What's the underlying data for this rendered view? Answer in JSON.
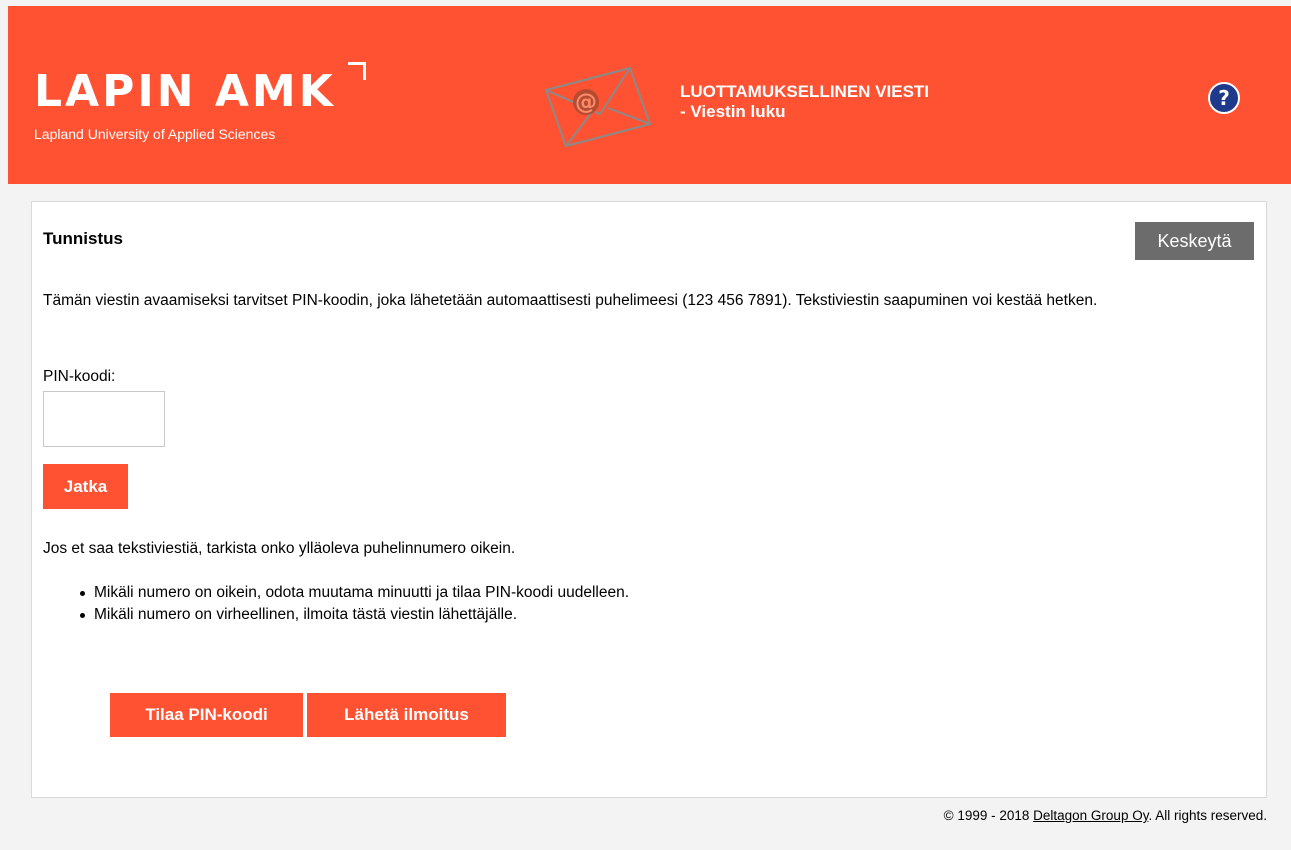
{
  "header": {
    "logo_main": "LAPIN AMK",
    "logo_sub": "Lapland University of Applied Sciences",
    "title_line1": "LUOTTAMUKSELLINEN VIESTI",
    "title_line2": "- Viestin luku",
    "help_icon": "question-mark-circle-icon",
    "envelope_icon": "email-envelope-icon"
  },
  "panel": {
    "title": "Tunnistus",
    "cancel_label": "Keskeytä",
    "intro_text": "Tämän viestin avaamiseksi tarvitset PIN-koodin, joka lähetetään automaattisesti puhelimeesi (123 456 7891). Tekstiviestin saapuminen voi kestää hetken.",
    "pin_label": "PIN-koodi:",
    "pin_value": "",
    "continue_label": "Jatka",
    "info_text": "Jos et saa tekstiviestiä, tarkista onko ylläoleva puhelinnumero oikein.",
    "bullets": [
      "Mikäli numero on oikein, odota muutama minuutti ja tilaa PIN-koodi uudelleen.",
      "Mikäli numero on virheellinen, ilmoita tästä viestin lähettäjälle."
    ],
    "order_pin_label": "Tilaa PIN-koodi",
    "send_notice_label": "Lähetä ilmoitus"
  },
  "footer": {
    "prefix": "© 1999 - 2018 ",
    "link_text": "Deltagon Group Oy",
    "suffix": ". All rights reserved."
  },
  "colors": {
    "brand": "#ff5232",
    "cancel_button": "#6c6c6c",
    "help_icon": "#1f3a8a"
  }
}
